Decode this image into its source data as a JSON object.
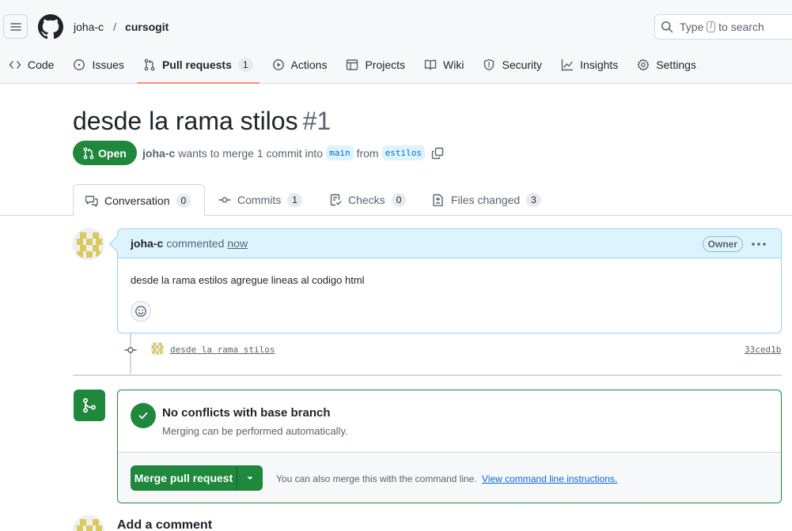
{
  "header": {
    "owner": "joha-c",
    "separator": "/",
    "repo": "cursogit",
    "search_prefix": "Type",
    "search_key": "/",
    "search_suffix": "to search"
  },
  "nav": {
    "items": [
      {
        "label": "Code",
        "icon": "code-icon"
      },
      {
        "label": "Issues",
        "icon": "issue-icon"
      },
      {
        "label": "Pull requests",
        "icon": "pull-request-icon",
        "count": "1",
        "selected": true
      },
      {
        "label": "Actions",
        "icon": "play-icon"
      },
      {
        "label": "Projects",
        "icon": "table-icon"
      },
      {
        "label": "Wiki",
        "icon": "book-icon"
      },
      {
        "label": "Security",
        "icon": "shield-icon"
      },
      {
        "label": "Insights",
        "icon": "graph-icon"
      },
      {
        "label": "Settings",
        "icon": "gear-icon"
      }
    ]
  },
  "pr": {
    "title": "desde la rama stilos",
    "number": "#1",
    "state": "Open",
    "author": "joha-c",
    "merge_text": "wants to merge 1 commit into",
    "base_branch": "main",
    "from_text": "from",
    "head_branch": "estilos"
  },
  "tabs": [
    {
      "label": "Conversation",
      "count": "0",
      "icon": "comment-discussion-icon"
    },
    {
      "label": "Commits",
      "count": "1",
      "icon": "commit-icon"
    },
    {
      "label": "Checks",
      "count": "0",
      "icon": "checklist-icon"
    },
    {
      "label": "Files changed",
      "count": "3",
      "icon": "file-diff-icon"
    }
  ],
  "comment": {
    "author": "joha-c",
    "action": "commented",
    "time": "now",
    "role": "Owner",
    "body": "desde la rama estilos agregue lineas al codigo html"
  },
  "commit": {
    "message": "desde la rama stilos",
    "sha": "33ced1b"
  },
  "merge": {
    "title": "No conflicts with base branch",
    "subtitle": "Merging can be performed automatically.",
    "button": "Merge pull request",
    "hint": "You can also merge this with the command line.",
    "hint_link": "View command line instructions."
  },
  "add_comment": {
    "heading": "Add a comment"
  },
  "colors": {
    "accent_green": "#1f883d",
    "link_blue": "#0969da",
    "comment_header_bg": "#ddf4ff",
    "nav_underline": "#fd8c73"
  }
}
